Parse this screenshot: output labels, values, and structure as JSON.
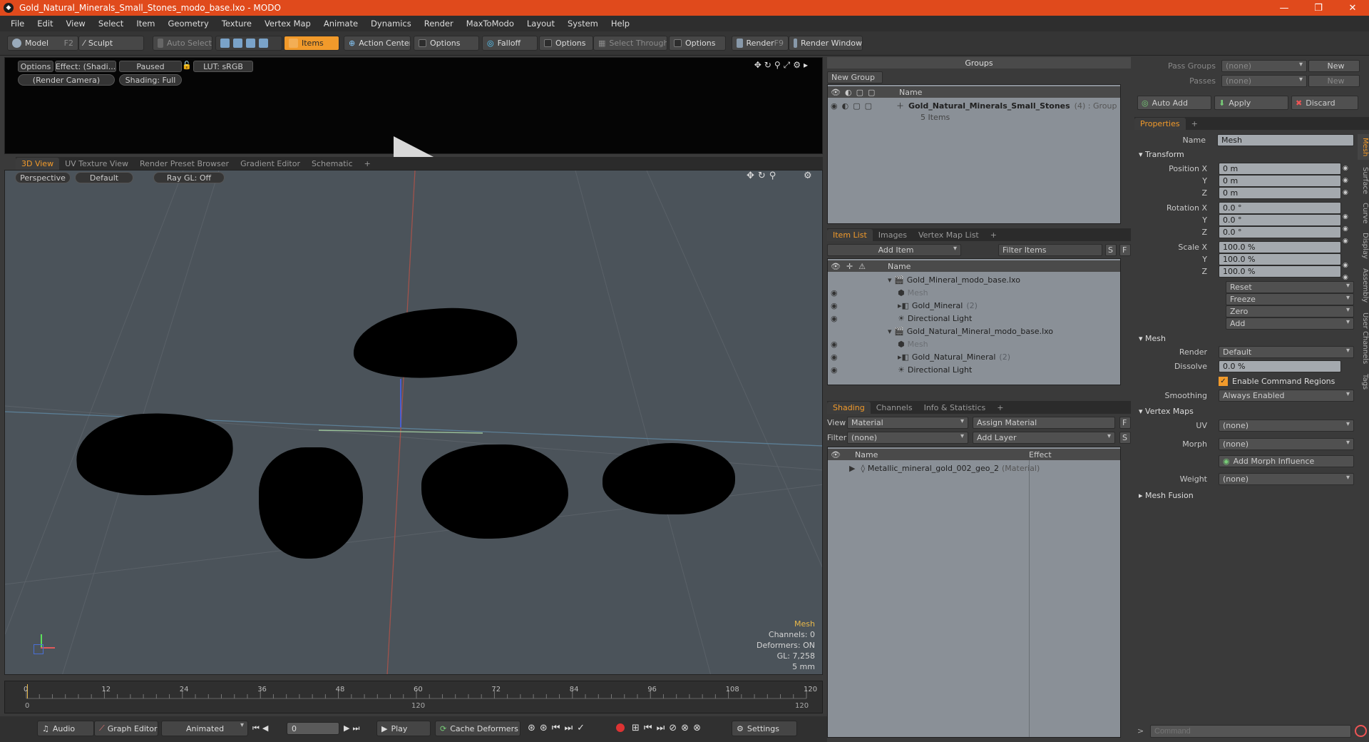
{
  "window": {
    "title": "Gold_Natural_Minerals_Small_Stones_modo_base.lxo - MODO",
    "minimize": "—",
    "restore": "❐",
    "close": "✕"
  },
  "menu": [
    "File",
    "Edit",
    "View",
    "Select",
    "Item",
    "Geometry",
    "Texture",
    "Vertex Map",
    "Animate",
    "Dynamics",
    "Render",
    "MaxToModo",
    "Layout",
    "System",
    "Help"
  ],
  "toolbar": {
    "model": "Model",
    "model_key": "F2",
    "sculpt": "Sculpt",
    "auto_select": "Auto Select",
    "items": "Items",
    "action_center": "Action Center",
    "options1": "Options",
    "falloff": "Falloff",
    "options2": "Options",
    "select_through": "Select Through",
    "options3": "Options",
    "render": "Render",
    "render_key": "F9",
    "render_window": "Render Window"
  },
  "preview": {
    "options": "Options",
    "effect": "Effect: (Shadi...",
    "paused": "Paused",
    "lut": "LUT: sRGB",
    "camera": "(Render Camera)",
    "shading": "Shading: Full"
  },
  "viewport_tabs": [
    "3D View",
    "UV Texture View",
    "Render Preset Browser",
    "Gradient Editor",
    "Schematic"
  ],
  "viewport": {
    "perspective": "Perspective",
    "default": "Default",
    "raygl": "Ray GL: Off",
    "hud": {
      "type": "Mesh",
      "channels": "Channels: 0",
      "deformers": "Deformers: ON",
      "gl": "GL: 7,258",
      "scale": "5 mm"
    }
  },
  "timeline": {
    "ticks": [
      "0",
      "12",
      "24",
      "36",
      "48",
      "60",
      "72",
      "84",
      "96",
      "108",
      "120"
    ],
    "range_start": "0",
    "range_mid": "120",
    "range_end": "120"
  },
  "bottombar": {
    "audio": "Audio",
    "graph_editor": "Graph Editor",
    "animated": "Animated",
    "frame": "0",
    "play": "Play",
    "cache": "Cache Deformers",
    "settings": "Settings"
  },
  "groups": {
    "title": "Groups",
    "new_group": "New Group",
    "col_name": "Name",
    "item_name": "Gold_Natural_Minerals_Small_Stones",
    "item_meta": "(4) : Group",
    "item_sub": "5 Items"
  },
  "itemlist": {
    "tabs": [
      "Item List",
      "Images",
      "Vertex Map List"
    ],
    "add_item": "Add Item",
    "filter": "Filter Items",
    "col_name": "Name",
    "rows": [
      {
        "name": "Gold_Mineral_modo_base.lxo",
        "level": 0,
        "kind": "scene"
      },
      {
        "name": "Mesh",
        "level": 1,
        "kind": "mesh"
      },
      {
        "name": "Gold_Mineral",
        "count": "(2)",
        "level": 1,
        "kind": "group"
      },
      {
        "name": "Directional Light",
        "level": 1,
        "kind": "light"
      },
      {
        "name": "Gold_Natural_Mineral_modo_base.lxo",
        "level": 0,
        "kind": "scene"
      },
      {
        "name": "Mesh",
        "level": 1,
        "kind": "mesh"
      },
      {
        "name": "Gold_Natural_Mineral",
        "count": "(2)",
        "level": 1,
        "kind": "group"
      },
      {
        "name": "Directional Light",
        "level": 1,
        "kind": "light"
      }
    ]
  },
  "shading": {
    "tabs": [
      "Shading",
      "Channels",
      "Info & Statistics"
    ],
    "view_label": "View",
    "view_value": "Material",
    "assign": "Assign Material",
    "filter_label": "Filter",
    "filter_value": "(none)",
    "add_layer": "Add Layer",
    "col_name": "Name",
    "col_effect": "Effect",
    "row": "Metallic_mineral_gold_002_geo_2",
    "row_meta": "(Material)"
  },
  "passes": {
    "pass_groups": "Pass Groups",
    "pass_groups_val": "(none)",
    "new1": "New",
    "passes": "Passes",
    "passes_val": "(none)",
    "new2": "New",
    "auto_add": "Auto Add",
    "apply": "Apply",
    "discard": "Discard"
  },
  "properties": {
    "tab": "Properties",
    "name_label": "Name",
    "name_value": "Mesh",
    "transform": "Transform",
    "position_label": "Position X",
    "y": "Y",
    "z": "Z",
    "pos": [
      "0 m",
      "0 m",
      "0 m"
    ],
    "rotation_label": "Rotation X",
    "rot": [
      "0.0 °",
      "0.0 °",
      "0.0 °"
    ],
    "scale_label": "Scale X",
    "scl": [
      "100.0 %",
      "100.0 %",
      "100.0 %"
    ],
    "reset": "Reset",
    "freeze": "Freeze",
    "zero": "Zero",
    "add": "Add",
    "mesh": "Mesh",
    "render_label": "Render",
    "render_val": "Default",
    "dissolve_label": "Dissolve",
    "dissolve_val": "0.0 %",
    "cmd_regions": "Enable Command Regions",
    "smoothing_label": "Smoothing",
    "smoothing_val": "Always Enabled",
    "vertex_maps": "Vertex Maps",
    "uv_label": "UV",
    "uv_val": "(none)",
    "morph_label": "Morph",
    "morph_val": "(none)",
    "add_morph": "Add Morph Influence",
    "weight_label": "Weight",
    "weight_val": "(none)",
    "mesh_fusion": "Mesh Fusion",
    "vtabs": [
      "Mesh",
      "Surface",
      "Curve",
      "Display",
      "Assembly",
      "User Channels",
      "Tags"
    ]
  },
  "command": {
    "placeholder": "Command"
  },
  "colors": {
    "accent": "#f19a2b",
    "title": "#e04a1c"
  }
}
